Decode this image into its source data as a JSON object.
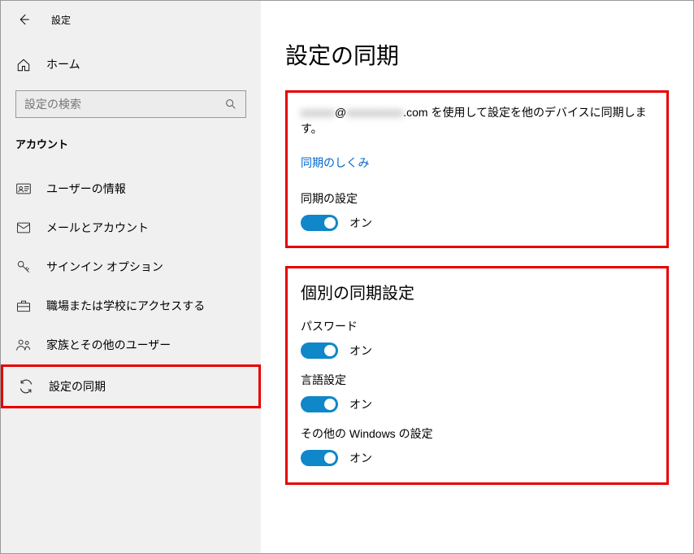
{
  "header": {
    "title": "設定"
  },
  "home": {
    "label": "ホーム"
  },
  "search": {
    "placeholder": "設定の検索"
  },
  "section": {
    "title": "アカウント"
  },
  "nav": [
    {
      "label": "ユーザーの情報"
    },
    {
      "label": "メールとアカウント"
    },
    {
      "label": "サインイン オプション"
    },
    {
      "label": "職場または学校にアクセスする"
    },
    {
      "label": "家族とその他のユーザー"
    },
    {
      "label": "設定の同期"
    }
  ],
  "main": {
    "title": "設定の同期",
    "account_prefix": "xxxxxx",
    "account_at": "@",
    "account_domain": "xxxxxxxxxx",
    "account_suffix": ".com を使用して設定を他のデバイスに同期します。",
    "how_link": "同期のしくみ",
    "master_label": "同期の設定",
    "master_state": "オン",
    "individual_title": "個別の同期設定",
    "items": [
      {
        "label": "パスワード",
        "state": "オン"
      },
      {
        "label": "言語設定",
        "state": "オン"
      },
      {
        "label": "その他の Windows の設定",
        "state": "オン"
      }
    ]
  }
}
